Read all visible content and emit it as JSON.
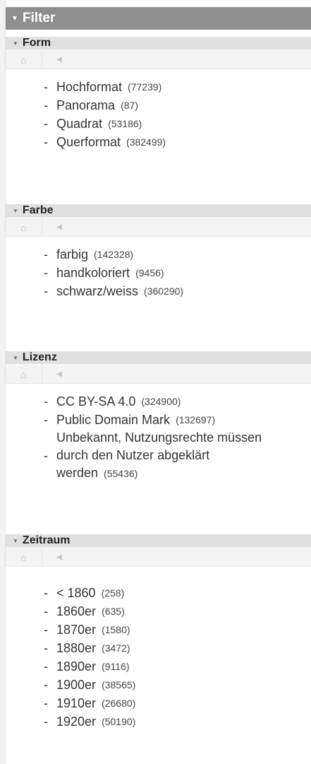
{
  "filter_title": "Filter",
  "sections": [
    {
      "title": "Form",
      "items": [
        {
          "label": "Hochformat",
          "count": "(77239)"
        },
        {
          "label": "Panorama",
          "count": "(87)"
        },
        {
          "label": "Quadrat",
          "count": "(53186)"
        },
        {
          "label": "Querformat",
          "count": "(382499)"
        }
      ]
    },
    {
      "title": "Farbe",
      "items": [
        {
          "label": "farbig",
          "count": "(142328)"
        },
        {
          "label": "handkoloriert",
          "count": "(9456)"
        },
        {
          "label": "schwarz/weiss",
          "count": "(360290)"
        }
      ]
    },
    {
      "title": "Lizenz",
      "items": [
        {
          "label": "CC BY-SA 4.0",
          "count": "(324900)"
        },
        {
          "label": "Public Domain Mark",
          "count": "(132697)"
        },
        {
          "label": "Unbekannt, Nutzungsrechte müssen durch den Nutzer abgeklärt werden",
          "count": "(55436)"
        }
      ]
    },
    {
      "title": "Zeitraum",
      "items": [
        {
          "label": "< 1860",
          "count": "(258)"
        },
        {
          "label": "1860er",
          "count": "(635)"
        },
        {
          "label": "1870er",
          "count": "(1580)"
        },
        {
          "label": "1880er",
          "count": "(3472)"
        },
        {
          "label": "1890er",
          "count": "(9116)"
        },
        {
          "label": "1900er",
          "count": "(38565)"
        },
        {
          "label": "1910er",
          "count": "(26680)"
        },
        {
          "label": "1920er",
          "count": "(50190)"
        }
      ]
    }
  ],
  "icons": {
    "collapse": "triangle-down",
    "home": "home-icon",
    "back": "back-arrow-icon"
  },
  "glyphs": {
    "triangle": "▼",
    "home": "⌂",
    "back": "◀",
    "dash": "-"
  },
  "colors": {
    "header_bg": "#8e8e8e",
    "section_header_bg": "#e0e0e0",
    "toolbar_bg": "#f3f3f3"
  }
}
